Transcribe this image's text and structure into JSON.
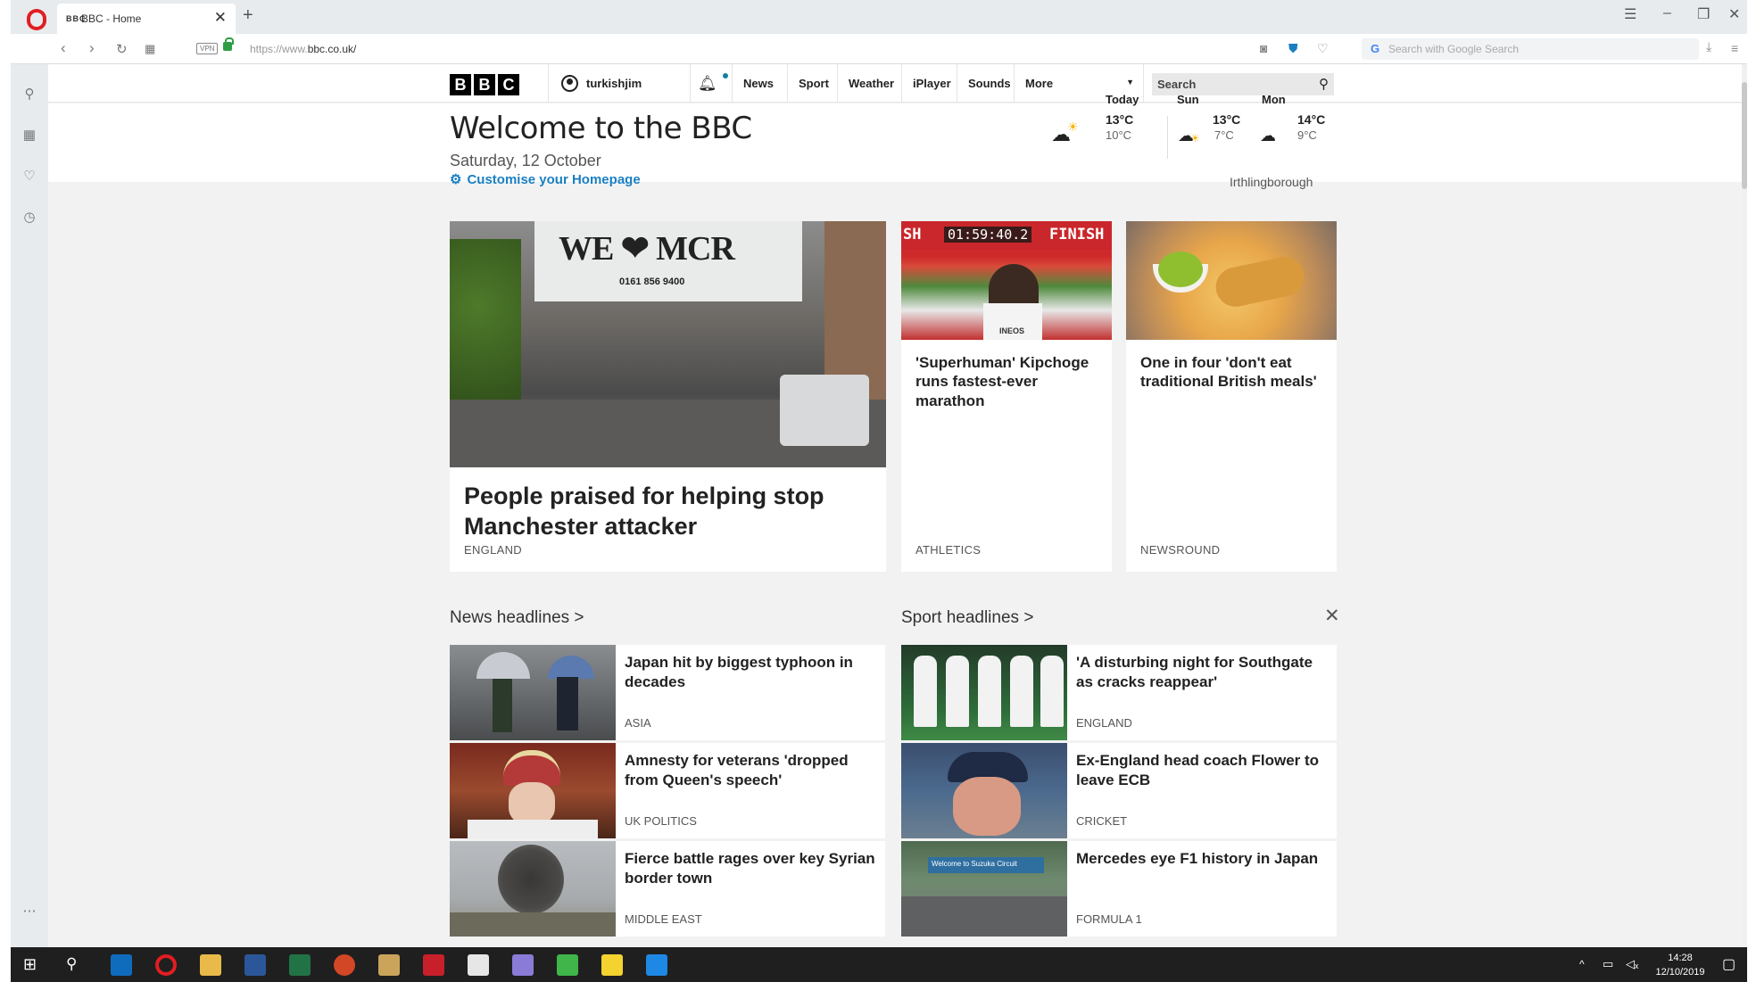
{
  "browser": {
    "tab_title": "BBC - Home",
    "tab_favicon": "BBC",
    "url_prefix": "https://www.",
    "url_domain": "bbc.co.uk/",
    "vpn_label": "VPN",
    "search_placeholder": "Search with Google Search"
  },
  "bbc_nav": {
    "logo": [
      "B",
      "B",
      "C"
    ],
    "username": "turkishjim",
    "items": [
      "News",
      "Sport",
      "Weather",
      "iPlayer",
      "Sounds",
      "More"
    ],
    "search_label": "Search"
  },
  "welcome": {
    "title": "Welcome to the BBC",
    "date": "Saturday, 12 October",
    "customise": "Customise your Homepage"
  },
  "weather": {
    "location": "Irthlingborough",
    "days": [
      {
        "day": "Today",
        "high": "13°C",
        "low": "10°C"
      },
      {
        "day": "Sun",
        "high": "13°C",
        "low": "7°C"
      },
      {
        "day": "Mon",
        "high": "14°C",
        "low": "9°C"
      }
    ]
  },
  "promos": [
    {
      "title": "People praised for helping stop Manchester attacker",
      "tag": "ENGLAND",
      "image_text": "WE ❤ MCR",
      "image_subtext": "0161 856 9400"
    },
    {
      "title": "'Superhuman' Kipchoge runs fastest-ever marathon",
      "tag": "ATHLETICS",
      "clock": "01:59:40.2",
      "finish": "FINISH",
      "sh": "SH",
      "sponsor": "INEOS"
    },
    {
      "title": "One in four 'don't eat traditional British meals'",
      "tag": "NEWSROUND"
    }
  ],
  "news_headlines": {
    "heading": "News headlines",
    "items": [
      {
        "title": "Japan hit by biggest typhoon in decades",
        "tag": "ASIA"
      },
      {
        "title": "Amnesty for veterans 'dropped from Queen's speech'",
        "tag": "UK POLITICS"
      },
      {
        "title": "Fierce battle rages over key Syrian border town",
        "tag": "MIDDLE EAST"
      }
    ]
  },
  "sport_headlines": {
    "heading": "Sport headlines",
    "items": [
      {
        "title": "'A disturbing night for Southgate as cracks reappear'",
        "tag": "ENGLAND"
      },
      {
        "title": "Ex-England head coach Flower to leave ECB",
        "tag": "CRICKET"
      },
      {
        "title": "Mercedes eye F1 history in Japan",
        "tag": "FORMULA 1"
      }
    ],
    "suzuka_banner": "Welcome to Suzuka Circuit"
  },
  "taskbar": {
    "time": "14:28",
    "date": "12/10/2019"
  },
  "colors": {
    "bbc_blue_link": "#1a7fc1",
    "opera_red": "#e01e22",
    "page_bg": "#f2f2f2"
  }
}
